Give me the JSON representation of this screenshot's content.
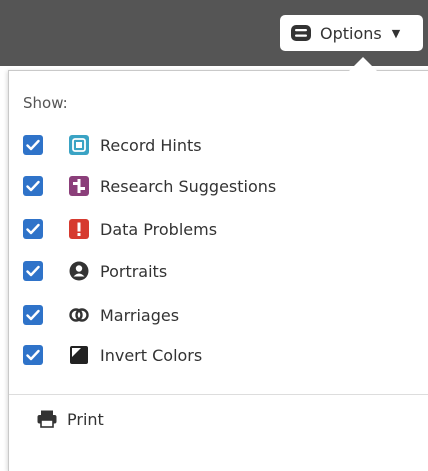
{
  "header": {
    "options_label": "Options",
    "options_icon": "options-stack-icon",
    "caret_icon": "caret-down-icon"
  },
  "panel": {
    "show_label": "Show:",
    "items": [
      {
        "label": "Record Hints",
        "checked": true,
        "icon": "record-hints-icon",
        "icon_color": "#3aa3c4"
      },
      {
        "label": "Research Suggestions",
        "checked": true,
        "icon": "research-suggestions-icon",
        "icon_color": "#8b3f7a"
      },
      {
        "label": "Data Problems",
        "checked": true,
        "icon": "data-problems-icon",
        "icon_color": "#d63a2f"
      },
      {
        "label": "Portraits",
        "checked": true,
        "icon": "portraits-icon",
        "icon_color": "#333333"
      },
      {
        "label": "Marriages",
        "checked": true,
        "icon": "marriages-icon",
        "icon_color": "#333333"
      },
      {
        "label": "Invert Colors",
        "checked": true,
        "icon": "invert-colors-icon",
        "icon_color": "#222222"
      }
    ],
    "print_label": "Print",
    "print_icon": "printer-icon"
  },
  "colors": {
    "topbar": "#555555",
    "checkbox": "#2f73c9",
    "text": "#333333"
  }
}
